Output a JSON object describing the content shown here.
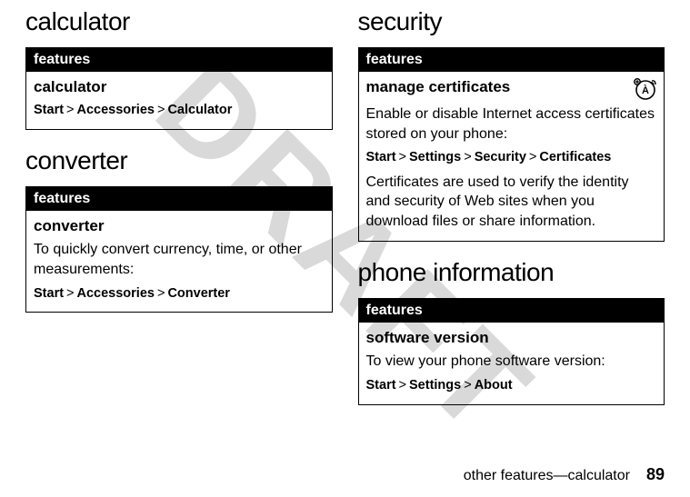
{
  "watermark": "DRAFT",
  "left": {
    "sec1": {
      "heading": "calculator",
      "features_label": "features",
      "title": "calculator",
      "path": [
        "Start",
        "Accessories",
        "Calculator"
      ]
    },
    "sec2": {
      "heading": "converter",
      "features_label": "features",
      "title": "converter",
      "desc": "To quickly convert currency, time, or other measurements:",
      "path": [
        "Start",
        "Accessories",
        "Converter"
      ]
    }
  },
  "right": {
    "sec1": {
      "heading": "security",
      "features_label": "features",
      "title": "manage certificates",
      "desc1": "Enable or disable Internet access certificates stored on your phone:",
      "path": [
        "Start",
        "Settings",
        "Security",
        "Certificates"
      ],
      "desc2": "Certificates are used to verify the identity and security of Web sites when you download files or share information."
    },
    "sec2": {
      "heading": "phone information",
      "features_label": "features",
      "title": "software version",
      "desc": "To view your phone software version:",
      "path": [
        "Start",
        "Settings",
        "About"
      ]
    }
  },
  "footer": {
    "text": "other features—calculator",
    "page": "89"
  },
  "sep": ">"
}
